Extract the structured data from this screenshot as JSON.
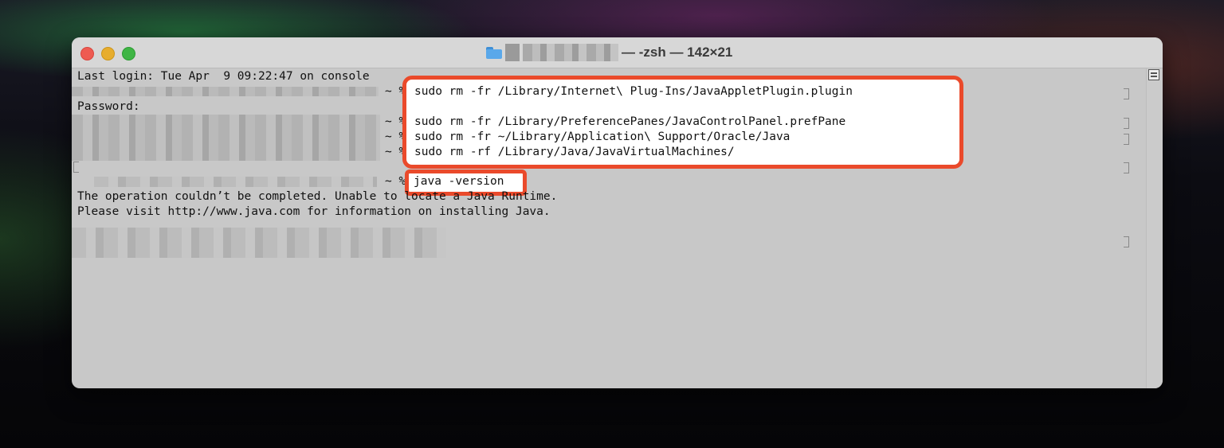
{
  "window": {
    "title_suffix": "— -zsh — 142×21"
  },
  "terminal": {
    "last_login": "Last login: Tue Apr  9 09:22:47 on console",
    "password_prompt": "Password:",
    "prompt_suffix": "~ %",
    "commands_box": [
      "sudo rm -fr /Library/Internet\\ Plug-Ins/JavaAppletPlugin.plugin",
      "",
      "sudo rm -fr /Library/PreferencePanes/JavaControlPanel.prefPane",
      "sudo rm -fr ~/Library/Application\\ Support/Oracle/Java",
      "sudo rm -rf /Library/Java/JavaVirtualMachines/"
    ],
    "version_command": "java -version",
    "output_line_1": "The operation couldn’t be completed. Unable to locate a Java Runtime.",
    "output_line_2": "Please visit http://www.java.com for information on installing Java."
  },
  "colors": {
    "highlight": "#ea4a2b",
    "terminal_bg": "#c8c8c8"
  },
  "icons": [
    "folder-icon",
    "scroll-menu-icon"
  ]
}
